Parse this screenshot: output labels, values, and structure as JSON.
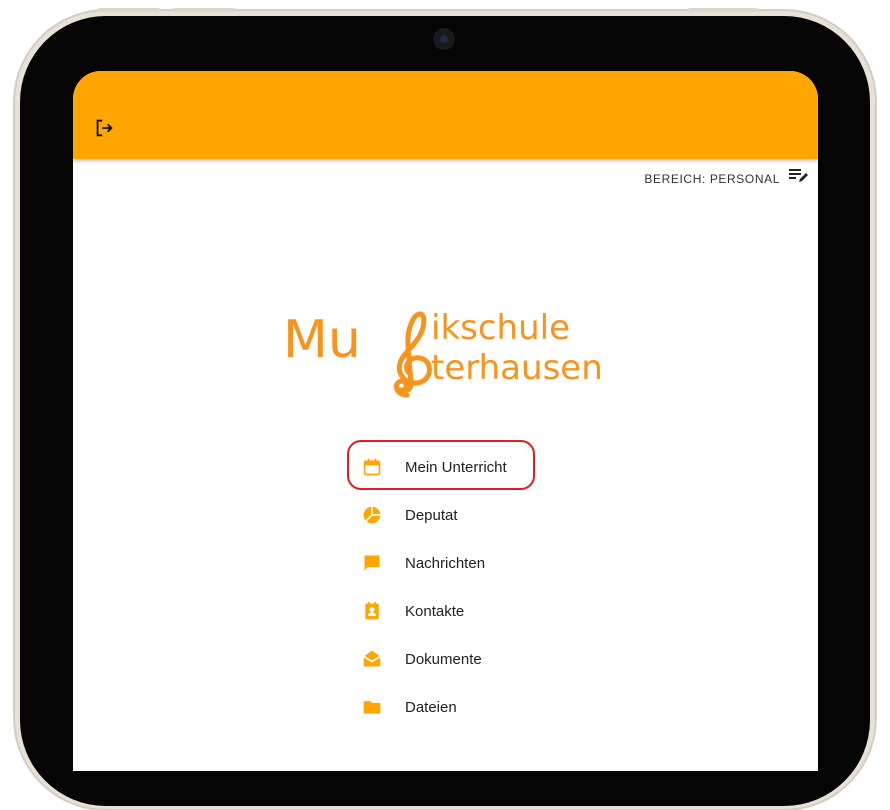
{
  "header": {
    "logout_icon": "logout-icon",
    "accent": "#ffa600"
  },
  "bereich": {
    "label": "BEREICH: PERSONAL",
    "icon": "edit-list-icon"
  },
  "logo": {
    "line1": "Mu",
    "line1_rest": "ikschule",
    "line2_rest": "terhausen",
    "color": "#f7941d"
  },
  "menu": {
    "items": [
      {
        "label": "Mein Unterricht",
        "icon": "calendar-icon",
        "highlighted": true
      },
      {
        "label": "Deputat",
        "icon": "pie-chart-icon"
      },
      {
        "label": "Nachrichten",
        "icon": "chat-icon"
      },
      {
        "label": "Kontakte",
        "icon": "contacts-icon"
      },
      {
        "label": "Dokumente",
        "icon": "mail-open-icon"
      },
      {
        "label": "Dateien",
        "icon": "folder-icon"
      }
    ],
    "highlight_color": "#e11d1d",
    "icon_color": "#ffa600"
  }
}
